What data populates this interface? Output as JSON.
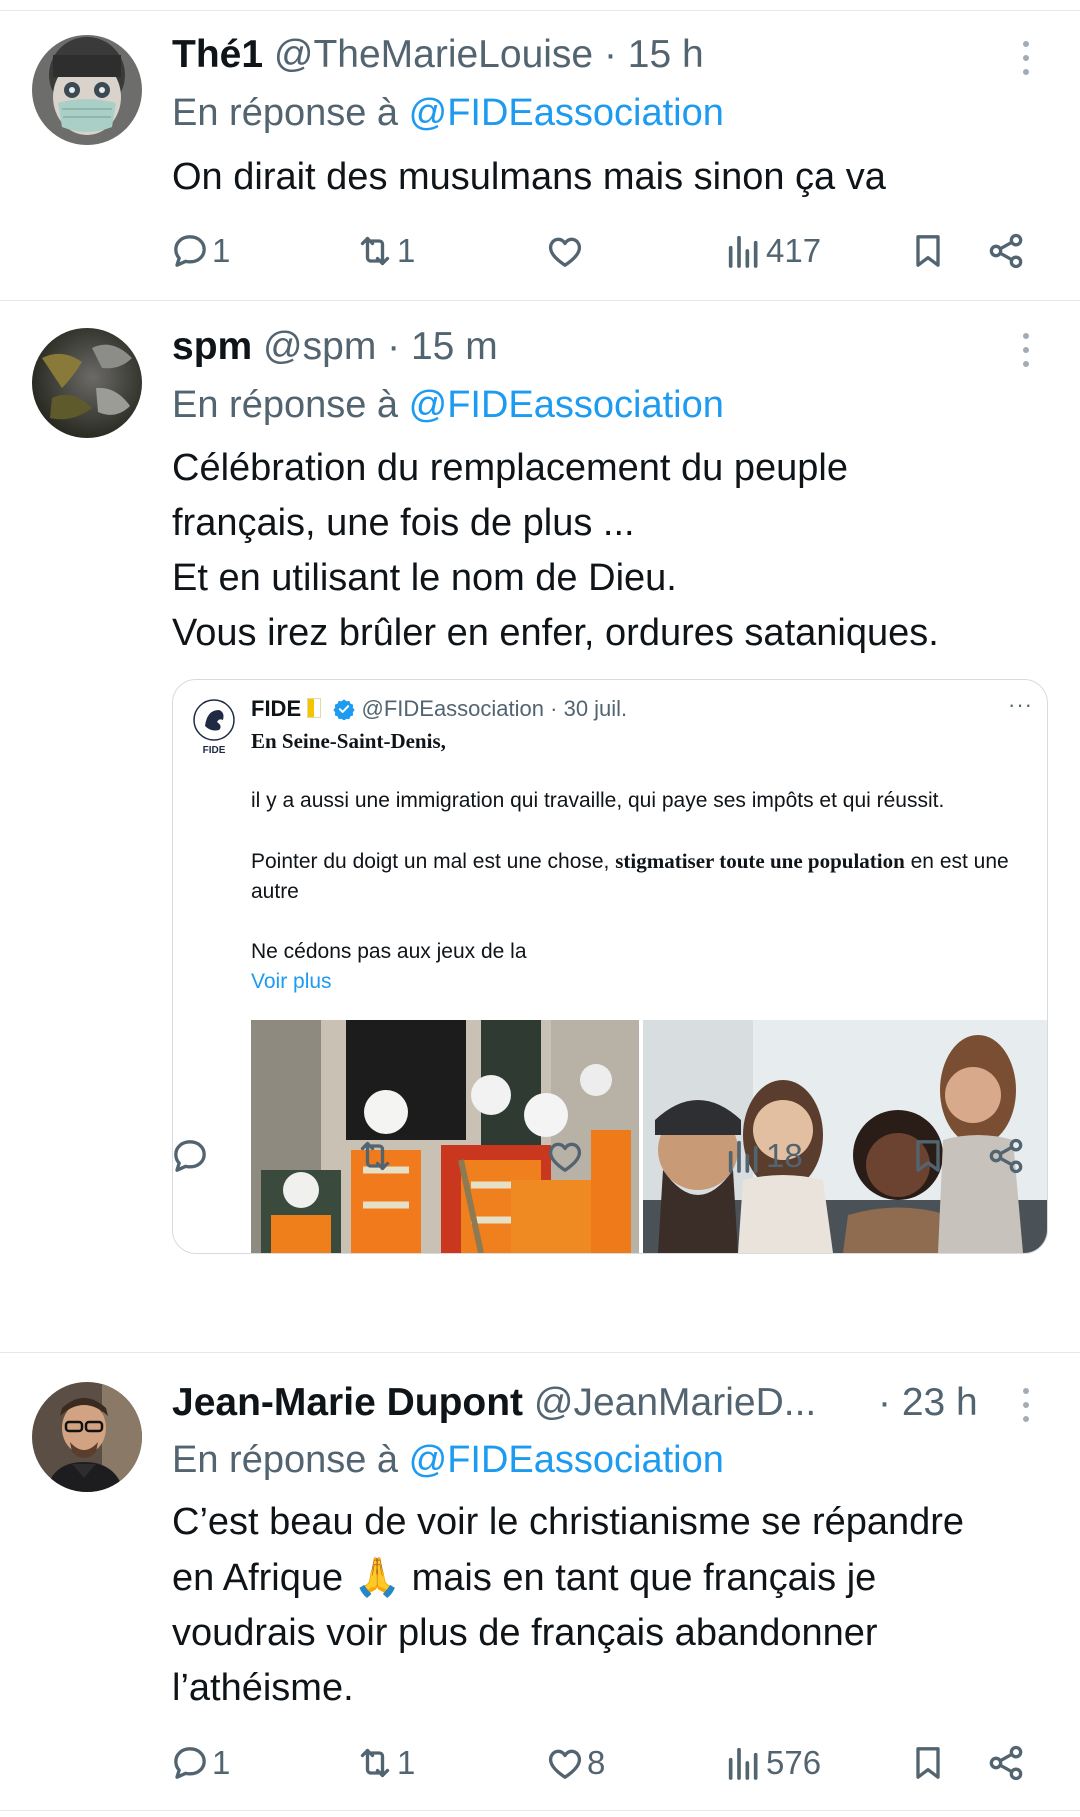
{
  "tweets": [
    {
      "name": "Thé1",
      "handle": "@TheMarieLouise",
      "time": "· 15 h",
      "reply_prefix": "En réponse à",
      "reply_to": "@FIDEassociation",
      "text": "On dirait des musulmans mais sinon ça va",
      "replies": "1",
      "retweets": "1",
      "likes": "",
      "views": "417"
    },
    {
      "name": "spm",
      "handle": "@spm",
      "time": "· 15 m",
      "reply_prefix": "En réponse à",
      "reply_to": "@FIDEassociation",
      "text_lines": [
        "Célébration du remplacement du peuple",
        "français, une fois de plus ...",
        "Et en utilisant le nom de Dieu.",
        "Vous irez brûler en enfer, ordures sataniques."
      ],
      "replies": "",
      "retweets": "",
      "likes": "",
      "views": "18",
      "quote": {
        "logo_text": "FIDE",
        "name": "FIDE",
        "handle": "@FIDEassociation",
        "time": "· 30 juil.",
        "more": "···",
        "lines": [
          "En Seine-Saint-Denis,",
          "il y a aussi une immigration qui travaille, qui paye ses impôts et qui réussit.",
          "Pointer du doigt un mal est une chose, ",
          "stigmatiser toute une population",
          " en est une autre",
          "Ne cédons pas aux jeux de la",
          "Voir plus"
        ]
      }
    },
    {
      "name": "Jean-Marie Dupont",
      "handle": "@JeanMarieD...",
      "time": "· 23 h",
      "reply_prefix": "En réponse à",
      "reply_to": "@FIDEassociation",
      "text_lines": [
        "C’est beau de voir le christianisme se répandre",
        "en Afrique",
        "🙏",
        " mais en tant que français je",
        "voudrais voir plus de français abandonner",
        "l’athéisme."
      ],
      "replies": "1",
      "retweets": "1",
      "likes": "8",
      "views": "576"
    }
  ],
  "colors": {
    "text": "#0f1419",
    "muted": "#536471",
    "link": "#1d9bf0",
    "verified": "#1d9bf0",
    "divider": "#e6e9ec"
  },
  "icons": [
    "reply-icon",
    "retweet-icon",
    "like-icon",
    "views-icon",
    "bookmark-icon",
    "share-icon",
    "more-icon",
    "verified-icon"
  ]
}
